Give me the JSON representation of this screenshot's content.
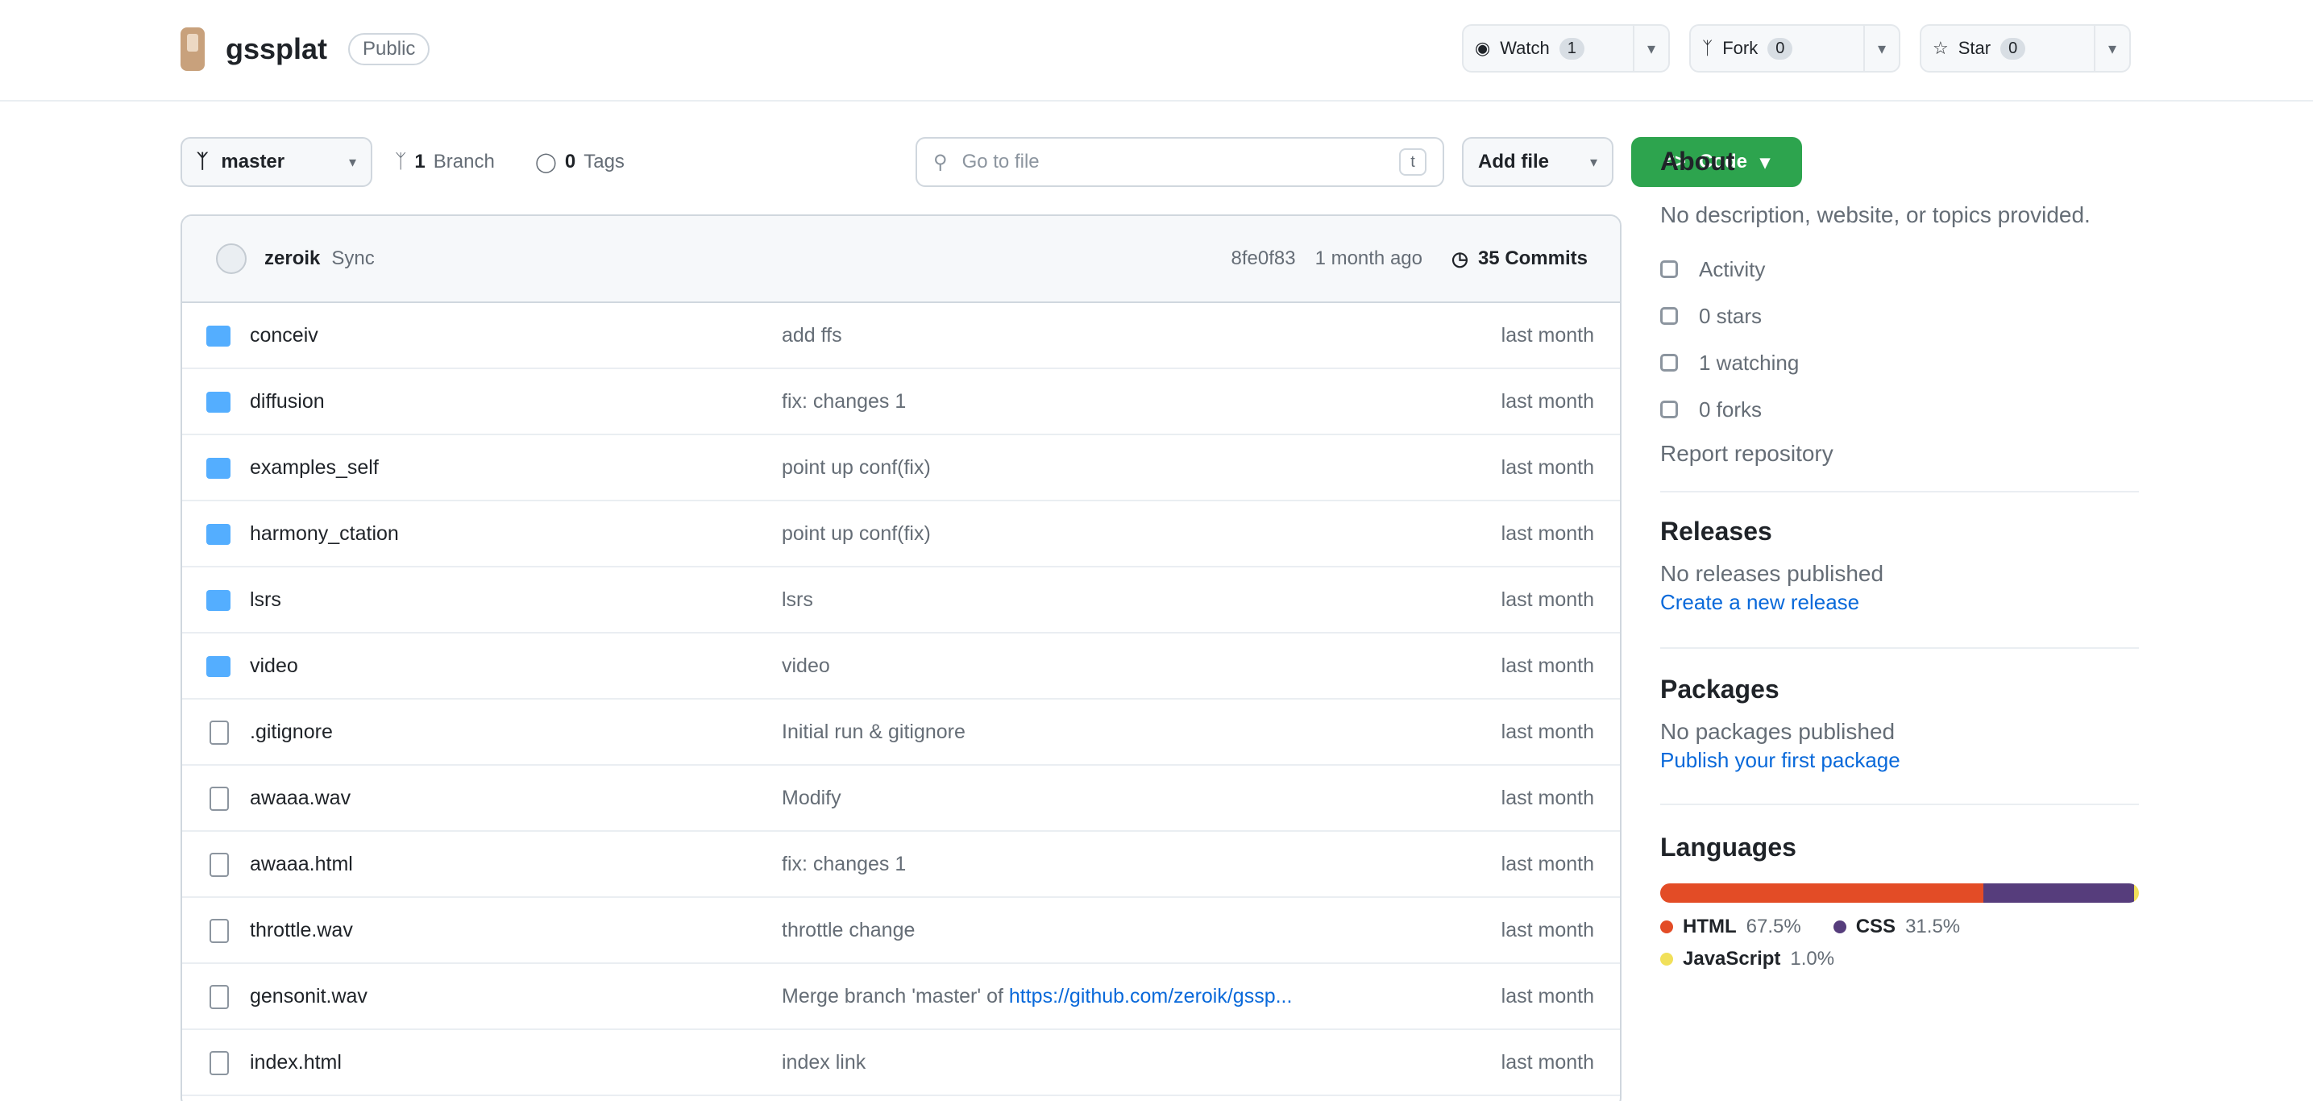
{
  "repo": {
    "name": "gssplat",
    "visibility": "Public"
  },
  "header_buttons": {
    "watch": {
      "label": "Watch",
      "count": "1"
    },
    "fork": {
      "label": "Fork",
      "count": "0"
    },
    "star": {
      "label": "Star",
      "count": "0"
    }
  },
  "toolbar": {
    "branch": "master",
    "branches_count": "1",
    "branches_label": "Branch",
    "tags_count": "0",
    "tags_label": "Tags",
    "goto_placeholder": "Go to file",
    "goto_kbd": "t",
    "add_file": "Add file",
    "code": "Code"
  },
  "commit": {
    "author": "zeroik",
    "message": "Sync",
    "hash": "8fe0f83",
    "time": "1 month ago",
    "count": "35 Commits"
  },
  "files": [
    {
      "type": "folder",
      "name": "conceiv",
      "message": "add ffs",
      "time": "last month"
    },
    {
      "type": "folder",
      "name": "diffusion",
      "message": "fix: changes 1",
      "time": "last month"
    },
    {
      "type": "folder",
      "name": "examples_self",
      "message": "point up conf(fix)",
      "time": "last month"
    },
    {
      "type": "folder",
      "name": "harmony_ctation",
      "message": "point up conf(fix)",
      "time": "last month"
    },
    {
      "type": "folder",
      "name": "lsrs",
      "message": "lsrs",
      "time": "last month"
    },
    {
      "type": "folder",
      "name": "video",
      "message": "video",
      "time": "last month"
    },
    {
      "type": "file",
      "name": ".gitignore",
      "message": "Initial run & gitignore",
      "time": "last month"
    },
    {
      "type": "file",
      "name": "awaaa.wav",
      "message": "Modify",
      "time": "last month"
    },
    {
      "type": "file",
      "name": "awaaa.html",
      "message": "fix: changes 1",
      "time": "last month"
    },
    {
      "type": "file",
      "name": "throttle.wav",
      "message": "throttle change",
      "time": "last month"
    },
    {
      "type": "file",
      "name": "gensonit.wav",
      "message": "Merge branch 'master' of ",
      "link": "https://github.com/zeroik/gssp...",
      "time": "last month"
    },
    {
      "type": "file",
      "name": "index.html",
      "message": "index link",
      "time": "last month"
    }
  ],
  "about": {
    "title": "About",
    "description": "No description, website, or topics provided.",
    "items": [
      {
        "icon": "book-icon",
        "label": "Activity"
      },
      {
        "icon": "star-icon",
        "label": "0 stars"
      },
      {
        "icon": "eye-icon",
        "label": "1 watching"
      },
      {
        "icon": "fork-icon",
        "label": "0 forks"
      }
    ],
    "report": "Report repository"
  },
  "releases": {
    "title": "Releases",
    "text": "No releases published",
    "link": "Create a new release"
  },
  "packages": {
    "title": "Packages",
    "text": "No packages published",
    "link": "Publish your first package"
  },
  "languages": {
    "title": "Languages",
    "items": [
      {
        "name": "HTML",
        "percent": "67.5%",
        "value": 67.5,
        "color": "#e34c26"
      },
      {
        "name": "CSS",
        "percent": "31.5%",
        "value": 31.5,
        "color": "#563d7c"
      },
      {
        "name": "JavaScript",
        "percent": "1.0%",
        "value": 1.0,
        "color": "#f1e05a"
      }
    ]
  }
}
